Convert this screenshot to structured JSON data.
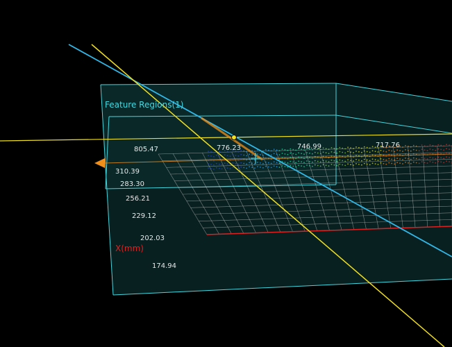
{
  "scene": {
    "feature_regions_label": "Feature Regions(1)",
    "axis_title": "X(mm)",
    "top_axis_ticks": [
      "805.47",
      "776.23",
      "746.99",
      "717.76"
    ],
    "side_axis_ticks": [
      "310.39",
      "283.30",
      "256.21",
      "229.12",
      "202.03",
      "174.94"
    ],
    "navigate_icon": "left-arrow-triangle-icon",
    "colors": {
      "background": "#000000",
      "box_edges": "#44d8e0",
      "box_fill": "#0a2a2a",
      "grid": "#d8d8d8",
      "grid_red_edge": "#e02020",
      "yellow_line": "#f0e020",
      "cyan_line": "#30b8e8",
      "orange_marker": "#f0901a",
      "axis_title": "#e02020"
    }
  }
}
